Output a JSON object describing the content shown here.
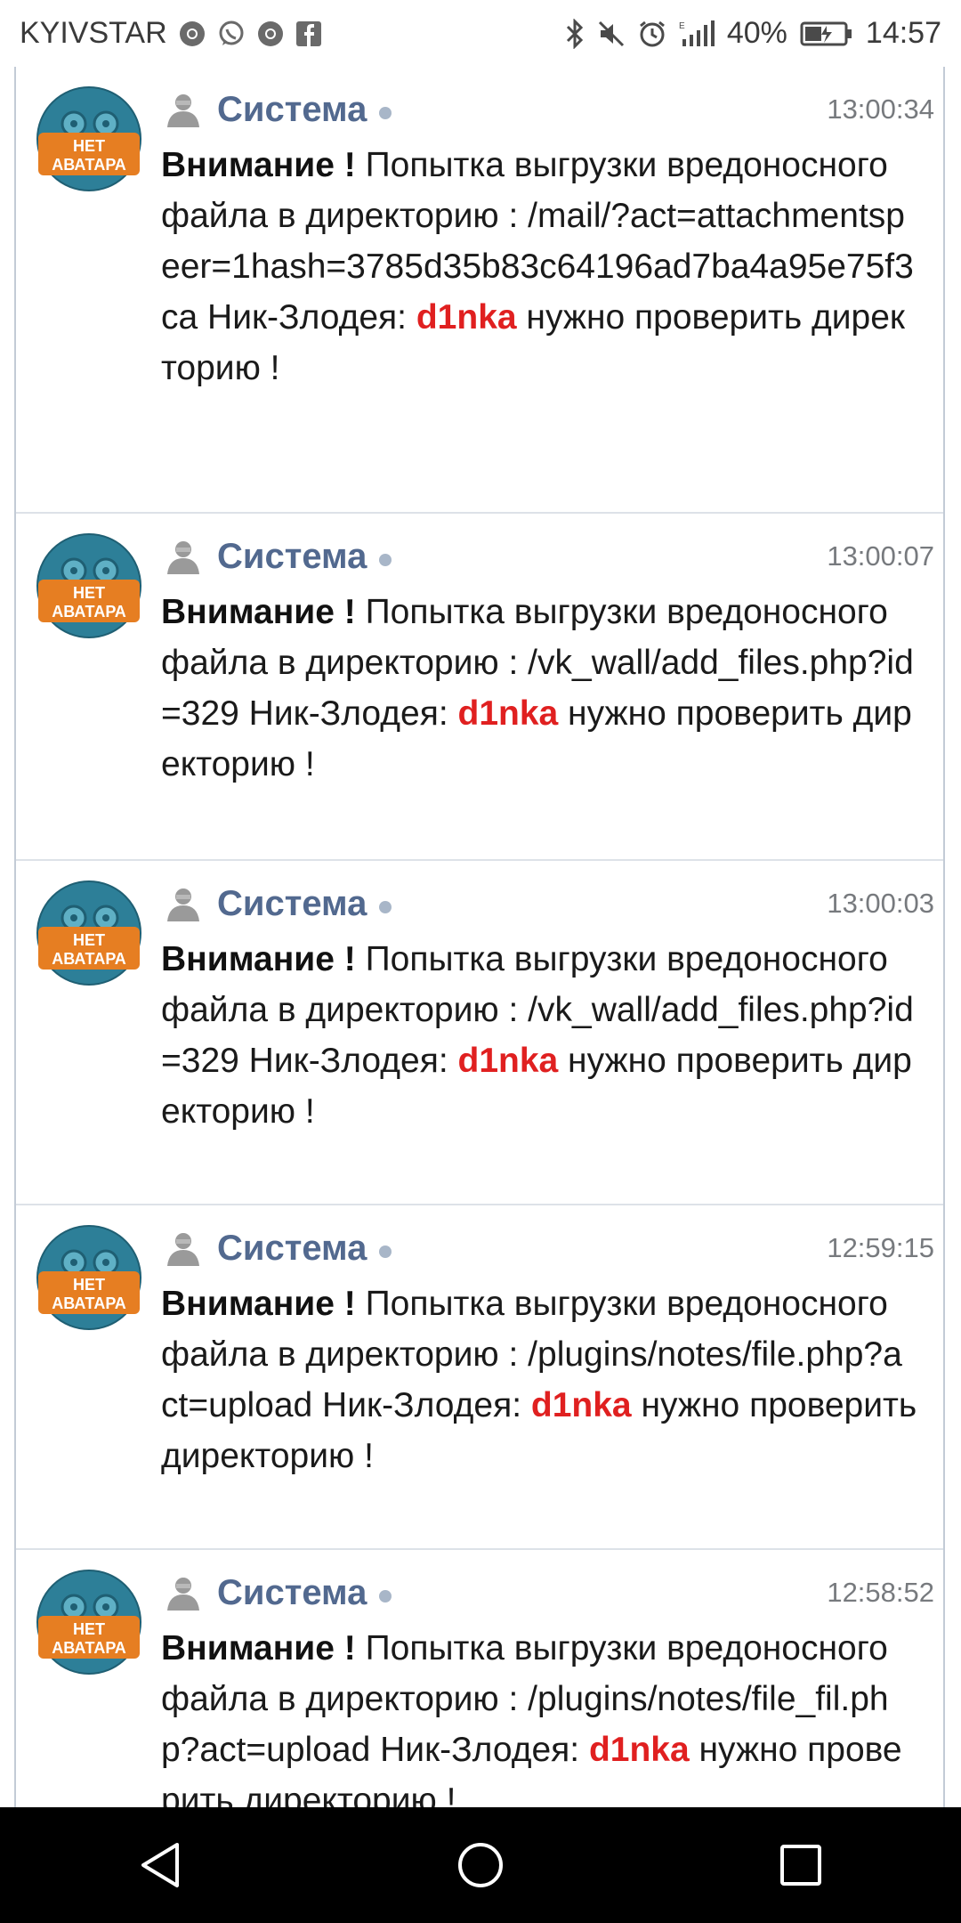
{
  "status_bar": {
    "carrier": "KYIVSTAR",
    "battery": "40%",
    "time": "14:57",
    "icons": [
      "chrome-icon",
      "whatsapp-icon",
      "chrome-icon",
      "facebook-icon",
      "bluetooth-icon",
      "mute-icon",
      "alarm-icon",
      "signal-icon",
      "battery-icon"
    ]
  },
  "colors": {
    "sender": "#52698f",
    "nick": "#e02020",
    "time": "#777a7e",
    "avatar": "#2d7f98"
  },
  "avatar_text": [
    "НЕТ",
    "АВАТАРА"
  ],
  "messages": [
    {
      "sender": "Система",
      "time": "13:00:34",
      "warn": "Внимание !",
      "text1": " Попытка выгрузки вредоносного файла в директорию : /mail/?act=attachmentspeer=1hash=3785d35b83c64196ad7ba4a95e75f3ca Ник-Злодея: ",
      "nick": "d1nka",
      "text2": " нужно проверить директорию !"
    },
    {
      "sender": "Система",
      "time": "13:00:07",
      "warn": "Внимание !",
      "text1": " Попытка выгрузки вредоносного файла в директорию : /vk_wall/add_files.php?id=329 Ник-Злодея: ",
      "nick": "d1nka",
      "text2": " нужно проверить директорию !"
    },
    {
      "sender": "Система",
      "time": "13:00:03",
      "warn": "Внимание !",
      "text1": " Попытка выгрузки вредоносного файла в директорию : /vk_wall/add_files.php?id=329 Ник-Злодея: ",
      "nick": "d1nka",
      "text2": " нужно проверить директорию !"
    },
    {
      "sender": "Система",
      "time": "12:59:15",
      "warn": "Внимание !",
      "text1": " Попытка выгрузки вредоносного файла в директорию : /plugins/notes/file.php?act=upload Ник-Злодея: ",
      "nick": "d1nka",
      "text2": " нужно проверить директорию !"
    },
    {
      "sender": "Система",
      "time": "12:58:52",
      "warn": "Внимание !",
      "text1": " Попытка выгрузки вредоносного файла в директорию : /plugins/notes/file_fil.php?act=upload Ник-Злодея: ",
      "nick": "d1nka",
      "text2": " нужно проверить директорию !"
    }
  ],
  "nav_bar": [
    "back-icon",
    "home-icon",
    "recents-icon"
  ]
}
